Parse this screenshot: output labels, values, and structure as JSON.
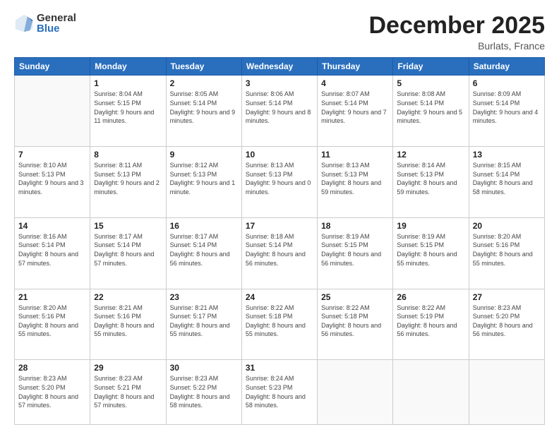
{
  "logo": {
    "general": "General",
    "blue": "Blue"
  },
  "title": "December 2025",
  "location": "Burlats, France",
  "weekdays": [
    "Sunday",
    "Monday",
    "Tuesday",
    "Wednesday",
    "Thursday",
    "Friday",
    "Saturday"
  ],
  "days": [
    {
      "date": "",
      "sunrise": "",
      "sunset": "",
      "daylight": ""
    },
    {
      "date": "1",
      "sunrise": "Sunrise: 8:04 AM",
      "sunset": "Sunset: 5:15 PM",
      "daylight": "Daylight: 9 hours and 11 minutes."
    },
    {
      "date": "2",
      "sunrise": "Sunrise: 8:05 AM",
      "sunset": "Sunset: 5:14 PM",
      "daylight": "Daylight: 9 hours and 9 minutes."
    },
    {
      "date": "3",
      "sunrise": "Sunrise: 8:06 AM",
      "sunset": "Sunset: 5:14 PM",
      "daylight": "Daylight: 9 hours and 8 minutes."
    },
    {
      "date": "4",
      "sunrise": "Sunrise: 8:07 AM",
      "sunset": "Sunset: 5:14 PM",
      "daylight": "Daylight: 9 hours and 7 minutes."
    },
    {
      "date": "5",
      "sunrise": "Sunrise: 8:08 AM",
      "sunset": "Sunset: 5:14 PM",
      "daylight": "Daylight: 9 hours and 5 minutes."
    },
    {
      "date": "6",
      "sunrise": "Sunrise: 8:09 AM",
      "sunset": "Sunset: 5:14 PM",
      "daylight": "Daylight: 9 hours and 4 minutes."
    },
    {
      "date": "7",
      "sunrise": "Sunrise: 8:10 AM",
      "sunset": "Sunset: 5:13 PM",
      "daylight": "Daylight: 9 hours and 3 minutes."
    },
    {
      "date": "8",
      "sunrise": "Sunrise: 8:11 AM",
      "sunset": "Sunset: 5:13 PM",
      "daylight": "Daylight: 9 hours and 2 minutes."
    },
    {
      "date": "9",
      "sunrise": "Sunrise: 8:12 AM",
      "sunset": "Sunset: 5:13 PM",
      "daylight": "Daylight: 9 hours and 1 minute."
    },
    {
      "date": "10",
      "sunrise": "Sunrise: 8:13 AM",
      "sunset": "Sunset: 5:13 PM",
      "daylight": "Daylight: 9 hours and 0 minutes."
    },
    {
      "date": "11",
      "sunrise": "Sunrise: 8:13 AM",
      "sunset": "Sunset: 5:13 PM",
      "daylight": "Daylight: 8 hours and 59 minutes."
    },
    {
      "date": "12",
      "sunrise": "Sunrise: 8:14 AM",
      "sunset": "Sunset: 5:13 PM",
      "daylight": "Daylight: 8 hours and 59 minutes."
    },
    {
      "date": "13",
      "sunrise": "Sunrise: 8:15 AM",
      "sunset": "Sunset: 5:14 PM",
      "daylight": "Daylight: 8 hours and 58 minutes."
    },
    {
      "date": "14",
      "sunrise": "Sunrise: 8:16 AM",
      "sunset": "Sunset: 5:14 PM",
      "daylight": "Daylight: 8 hours and 57 minutes."
    },
    {
      "date": "15",
      "sunrise": "Sunrise: 8:17 AM",
      "sunset": "Sunset: 5:14 PM",
      "daylight": "Daylight: 8 hours and 57 minutes."
    },
    {
      "date": "16",
      "sunrise": "Sunrise: 8:17 AM",
      "sunset": "Sunset: 5:14 PM",
      "daylight": "Daylight: 8 hours and 56 minutes."
    },
    {
      "date": "17",
      "sunrise": "Sunrise: 8:18 AM",
      "sunset": "Sunset: 5:14 PM",
      "daylight": "Daylight: 8 hours and 56 minutes."
    },
    {
      "date": "18",
      "sunrise": "Sunrise: 8:19 AM",
      "sunset": "Sunset: 5:15 PM",
      "daylight": "Daylight: 8 hours and 56 minutes."
    },
    {
      "date": "19",
      "sunrise": "Sunrise: 8:19 AM",
      "sunset": "Sunset: 5:15 PM",
      "daylight": "Daylight: 8 hours and 55 minutes."
    },
    {
      "date": "20",
      "sunrise": "Sunrise: 8:20 AM",
      "sunset": "Sunset: 5:16 PM",
      "daylight": "Daylight: 8 hours and 55 minutes."
    },
    {
      "date": "21",
      "sunrise": "Sunrise: 8:20 AM",
      "sunset": "Sunset: 5:16 PM",
      "daylight": "Daylight: 8 hours and 55 minutes."
    },
    {
      "date": "22",
      "sunrise": "Sunrise: 8:21 AM",
      "sunset": "Sunset: 5:16 PM",
      "daylight": "Daylight: 8 hours and 55 minutes."
    },
    {
      "date": "23",
      "sunrise": "Sunrise: 8:21 AM",
      "sunset": "Sunset: 5:17 PM",
      "daylight": "Daylight: 8 hours and 55 minutes."
    },
    {
      "date": "24",
      "sunrise": "Sunrise: 8:22 AM",
      "sunset": "Sunset: 5:18 PM",
      "daylight": "Daylight: 8 hours and 55 minutes."
    },
    {
      "date": "25",
      "sunrise": "Sunrise: 8:22 AM",
      "sunset": "Sunset: 5:18 PM",
      "daylight": "Daylight: 8 hours and 56 minutes."
    },
    {
      "date": "26",
      "sunrise": "Sunrise: 8:22 AM",
      "sunset": "Sunset: 5:19 PM",
      "daylight": "Daylight: 8 hours and 56 minutes."
    },
    {
      "date": "27",
      "sunrise": "Sunrise: 8:23 AM",
      "sunset": "Sunset: 5:20 PM",
      "daylight": "Daylight: 8 hours and 56 minutes."
    },
    {
      "date": "28",
      "sunrise": "Sunrise: 8:23 AM",
      "sunset": "Sunset: 5:20 PM",
      "daylight": "Daylight: 8 hours and 57 minutes."
    },
    {
      "date": "29",
      "sunrise": "Sunrise: 8:23 AM",
      "sunset": "Sunset: 5:21 PM",
      "daylight": "Daylight: 8 hours and 57 minutes."
    },
    {
      "date": "30",
      "sunrise": "Sunrise: 8:23 AM",
      "sunset": "Sunset: 5:22 PM",
      "daylight": "Daylight: 8 hours and 58 minutes."
    },
    {
      "date": "31",
      "sunrise": "Sunrise: 8:24 AM",
      "sunset": "Sunset: 5:23 PM",
      "daylight": "Daylight: 8 hours and 58 minutes."
    }
  ]
}
